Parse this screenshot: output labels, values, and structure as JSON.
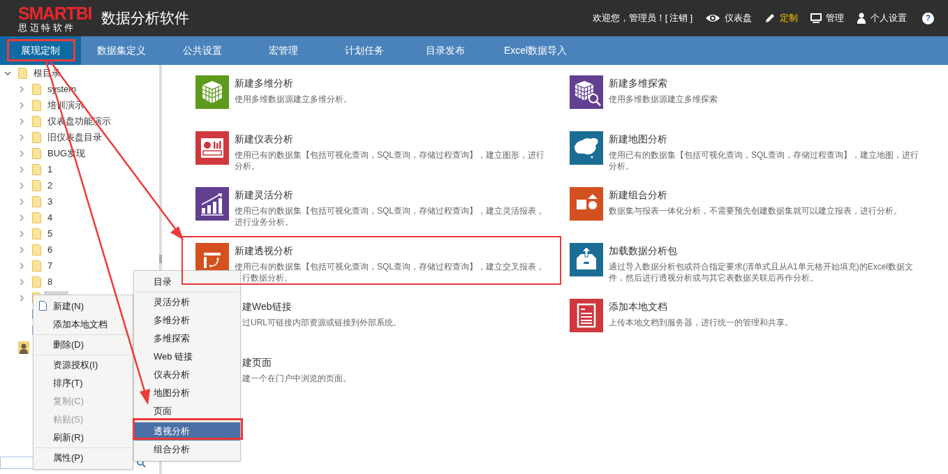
{
  "header": {
    "logo": "SMARTBI",
    "logo_subtitle": "思 迈 特 软 件",
    "title": "数据分析软件",
    "welcome": "欢迎您，管理员！[",
    "logout": "注销",
    "welcome_end": "]",
    "nav": [
      {
        "kind": "dashboard",
        "label": "仪表盘",
        "selected": false
      },
      {
        "kind": "customize",
        "label": "定制",
        "selected": true
      },
      {
        "kind": "admin",
        "label": "管理",
        "selected": false
      },
      {
        "kind": "settings",
        "label": "个人设置",
        "selected": false
      }
    ],
    "help": "?"
  },
  "tabs": [
    {
      "label": "展现定制",
      "selected": true
    },
    {
      "label": "数据集定义",
      "selected": false
    },
    {
      "label": "公共设置",
      "selected": false
    },
    {
      "label": "宏管理",
      "selected": false
    },
    {
      "label": "计划任务",
      "selected": false
    },
    {
      "label": "目录发布",
      "selected": false
    },
    {
      "label": "Excel数据导入",
      "selected": false
    }
  ],
  "tree": [
    {
      "kind": "folder",
      "label": "根目录",
      "expanded": true,
      "children": [
        {
          "kind": "folder",
          "label": "system",
          "expanded": false,
          "selected": false
        },
        {
          "kind": "folder",
          "label": "培训演示",
          "expanded": false,
          "selected": false
        },
        {
          "kind": "folder",
          "label": "仪表盘功能演示",
          "expanded": false,
          "selected": false
        },
        {
          "kind": "folder",
          "label": "旧仪表盘目录",
          "expanded": false,
          "selected": false
        },
        {
          "kind": "folder",
          "label": "BUG发现",
          "expanded": false,
          "selected": false
        },
        {
          "kind": "folder",
          "label": "1",
          "expanded": false,
          "selected": false
        },
        {
          "kind": "folder",
          "label": "2",
          "expanded": false,
          "selected": false
        },
        {
          "kind": "folder",
          "label": "3",
          "expanded": false,
          "selected": false
        },
        {
          "kind": "folder",
          "label": "4",
          "expanded": false,
          "selected": false
        },
        {
          "kind": "folder",
          "label": "5",
          "expanded": false,
          "selected": false
        },
        {
          "kind": "folder",
          "label": "6",
          "expanded": false,
          "selected": false
        },
        {
          "kind": "folder",
          "label": "7",
          "expanded": false,
          "selected": false
        },
        {
          "kind": "folder",
          "label": "8",
          "expanded": false,
          "selected": false
        },
        {
          "kind": "folder",
          "expanded": false,
          "selected": true
        },
        {
          "kind": "page",
          "selected": false
        },
        {
          "kind": "table",
          "selected": false
        }
      ]
    },
    {
      "kind": "user"
    }
  ],
  "cards": [
    {
      "kind": "cube",
      "color": "#5e9a1b",
      "title": "新建多维分析",
      "description": [
        "使用多维数据源建立多维分析。"
      ]
    },
    {
      "kind": "cube-search",
      "color": "#613f91",
      "title": "新建多维探索",
      "description": [
        "使用多维数据源建立多维探索"
      ]
    },
    {
      "kind": "dashboard",
      "color": "#d0383e",
      "title": "新建仪表分析",
      "description": [
        "使用已有的数据集【包括可视化查询，SQL查询，存储过程查询】，建立图形，进行",
        "分析。"
      ]
    },
    {
      "kind": "map",
      "color": "#1b6d96",
      "title": "新建地图分析",
      "description": [
        "使用已有的数据集【包括可视化查询，SQL查询，存储过程查询】，建立地图，进行",
        "分析。"
      ]
    },
    {
      "kind": "chart",
      "color": "#613f91",
      "title": "新建灵活分析",
      "description": [
        "使用已有的数据集【包括可视化查询，SQL查询，存储过程查询】，建立灵活报表，",
        "进行业务分析。"
      ]
    },
    {
      "kind": "combo",
      "color": "#d4511f",
      "title": "新建组合分析",
      "description": [
        "数据集与报表一体化分析，不需要预先创建数据集就可以建立报表，进行分析。"
      ]
    },
    {
      "kind": "pivot",
      "color": "#d4511f",
      "partly_covered": true,
      "title": "新建透视分析",
      "description": [
        "使用已有的数据集【包括可视化查询，SQL查询，存储过程查询】，建立交叉报表，",
        "行数据分析。"
      ]
    },
    {
      "kind": "package",
      "color": "#1b6d96",
      "title": "加载数据分析包",
      "description": [
        "通过导入数据分析包或符合指定要求(清单式且从A1单元格开始填充)的Excel数据文",
        "件，然后进行透视分析或与其它表数据关联后再作分析。"
      ]
    },
    {
      "kind": "hidden",
      "title": "建Web链接",
      "description": [
        "过URL可链接内部资源或链接到外部系统。"
      ]
    },
    {
      "kind": "document",
      "color": "#d0383e",
      "title": "添加本地文档",
      "description": [
        "上传本地文档到服务器，进行统一的管理和共享。"
      ]
    },
    {
      "kind": "hidden",
      "title": "建页面",
      "description": [
        "建一个在门户中浏览的页面。"
      ]
    }
  ],
  "context_menu": [
    {
      "kind": "item",
      "label": "新建(N)",
      "disabled": false,
      "icon": true
    },
    {
      "kind": "item",
      "label": "添加本地文档",
      "disabled": false
    },
    {
      "kind": "separator"
    },
    {
      "kind": "item",
      "label": "删除(D)",
      "disabled": false
    },
    {
      "kind": "separator"
    },
    {
      "kind": "item",
      "label": "资源授权(I)",
      "disabled": false
    },
    {
      "kind": "item",
      "label": "排序(T)",
      "disabled": false
    },
    {
      "kind": "item",
      "label": "复制(C)",
      "disabled": true
    },
    {
      "kind": "item",
      "label": "粘贴(S)",
      "disabled": true
    },
    {
      "kind": "item",
      "label": "刷新(R)",
      "disabled": false
    },
    {
      "kind": "separator"
    },
    {
      "kind": "item",
      "label": "属性(P)",
      "disabled": false
    }
  ],
  "submenu": [
    {
      "kind": "item",
      "label": "目录",
      "selected": false
    },
    {
      "kind": "separator"
    },
    {
      "kind": "item",
      "label": "灵活分析",
      "selected": false
    },
    {
      "kind": "item",
      "label": "多维分析",
      "selected": false
    },
    {
      "kind": "item",
      "label": "多维探索",
      "selected": false
    },
    {
      "kind": "item",
      "label": "Web 链接",
      "selected": false
    },
    {
      "kind": "item",
      "label": "仪表分析",
      "selected": false
    },
    {
      "kind": "item",
      "label": "地图分析",
      "selected": false
    },
    {
      "kind": "item",
      "label": "页面",
      "selected": false
    },
    {
      "kind": "separator"
    },
    {
      "kind": "item",
      "label": "透视分析",
      "selected": true
    },
    {
      "kind": "item",
      "label": "组合分析",
      "selected": false
    }
  ]
}
